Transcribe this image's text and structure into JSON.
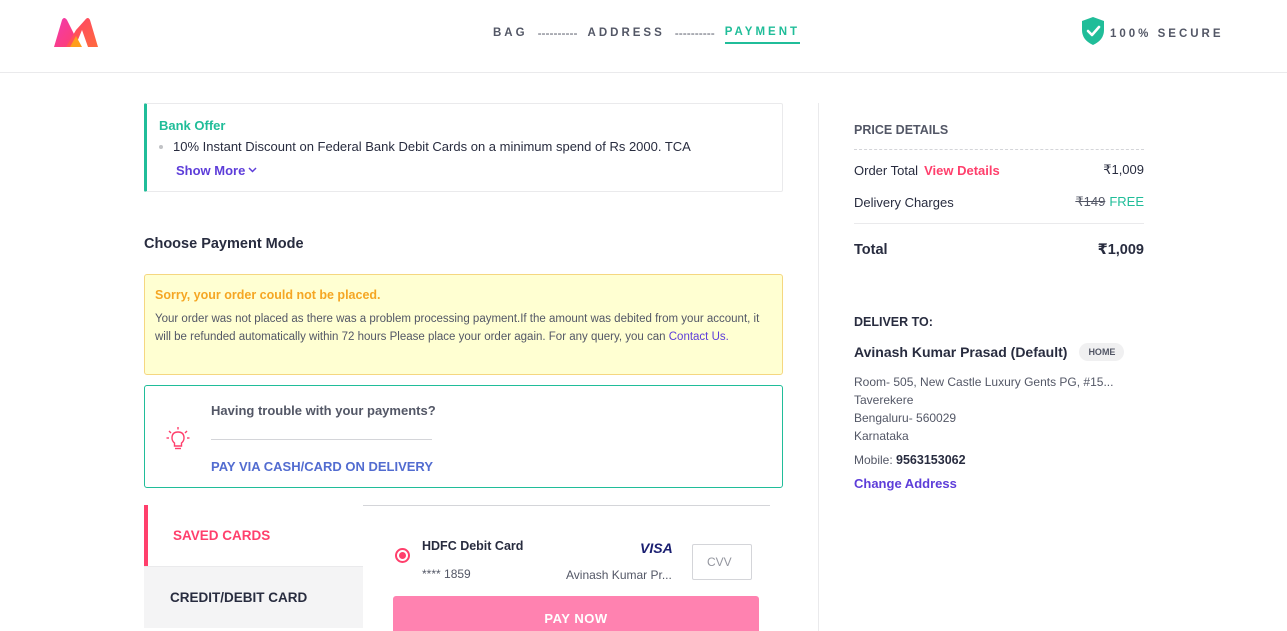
{
  "header": {
    "steps": [
      "BAG",
      "ADDRESS",
      "PAYMENT"
    ],
    "dashes": "----------",
    "secure_label": "100% SECURE"
  },
  "offer": {
    "title": "Bank Offer",
    "text": "10% Instant Discount on Federal Bank Debit Cards on a minimum spend of Rs 2000. TCA",
    "show_more": "Show More"
  },
  "payment": {
    "mode_title": "Choose Payment Mode",
    "error_title": "Sorry, your order could not be placed.",
    "error_body": "Your order was not placed as there was a problem processing payment.If the amount was debited from your account, it will be refunded automatically within 72 hours Please place your order again. For any query, you can",
    "contact_link": "Contact Us.",
    "trouble_title": "Having trouble with your payments?",
    "cod_link": "PAY VIA CASH/CARD ON DELIVERY",
    "tabs": [
      "SAVED CARDS",
      "CREDIT/DEBIT CARD"
    ],
    "card": {
      "name": "HDFC Debit Card",
      "number": "**** 1859",
      "network": "VISA",
      "holder": "Avinash Kumar Pr...",
      "cvv_placeholder": "CVV"
    },
    "pay_now": "PAY NOW"
  },
  "price_details": {
    "title": "PRICE DETAILS",
    "order_total_label": "Order Total",
    "view_details": "View Details",
    "order_total_value": "₹1,009",
    "delivery_label": "Delivery Charges",
    "delivery_original": "₹149",
    "delivery_free": "FREE",
    "total_label": "Total",
    "total_value": "₹1,009"
  },
  "delivery": {
    "title": "DELIVER TO:",
    "name": "Avinash Kumar Prasad (Default)",
    "badge": "HOME",
    "address_lines": [
      "Room- 505, New Castle Luxury Gents PG, #15...",
      "Taverekere",
      "Bengaluru- 560029",
      "Karnataka"
    ],
    "mobile_label": "Mobile:",
    "mobile": "9563153062",
    "change_address": "Change Address"
  },
  "colors": {
    "brand_pink": "#ff3f6c",
    "accent_green": "#20bd99",
    "link_purple": "#5d3dd9"
  }
}
